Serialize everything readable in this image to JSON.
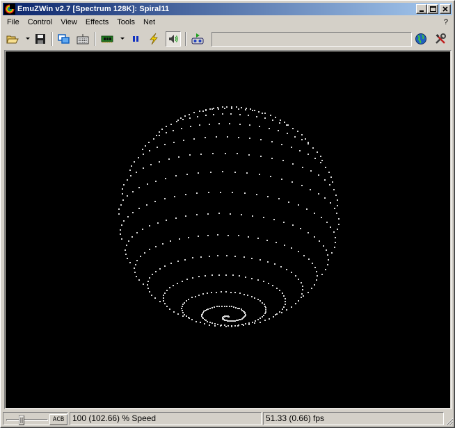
{
  "window": {
    "title": "EmuZWin v2.7 [Spectrum 128K]: Spiral11",
    "app_icon": "emuzwin-rainbow-icon",
    "caption_buttons": [
      "minimize-icon",
      "maximize-icon",
      "close-icon"
    ]
  },
  "menu": {
    "items": [
      {
        "label": "File"
      },
      {
        "label": "Control"
      },
      {
        "label": "View"
      },
      {
        "label": "Effects"
      },
      {
        "label": "Tools"
      },
      {
        "label": "Net"
      }
    ],
    "help_label": "?"
  },
  "toolbar": {
    "icons": [
      "open-folder-icon",
      "dropdown-arrow-icon",
      "save-disk-icon",
      "copy-windows-icon",
      "keyboard-icon",
      "memory-chip-icon",
      "dropdown-arrow-icon",
      "pause-icon",
      "lightning-icon",
      "speaker-icon",
      "tape-play-icon",
      "globe-icon",
      "tools-icon"
    ],
    "field_value": ""
  },
  "display": {
    "content": "spiral-sphere-demo",
    "background": "#000000",
    "dot_color": "#d8d8d8"
  },
  "statusbar": {
    "acb_label": "ACB",
    "speed_text": "100 (102.66) % Speed",
    "fps_text": "51.33 (0.66) fps"
  },
  "colors": {
    "titlebar_start": "#0a246a",
    "titlebar_end": "#a6caf0",
    "chrome": "#d4d0c8"
  }
}
